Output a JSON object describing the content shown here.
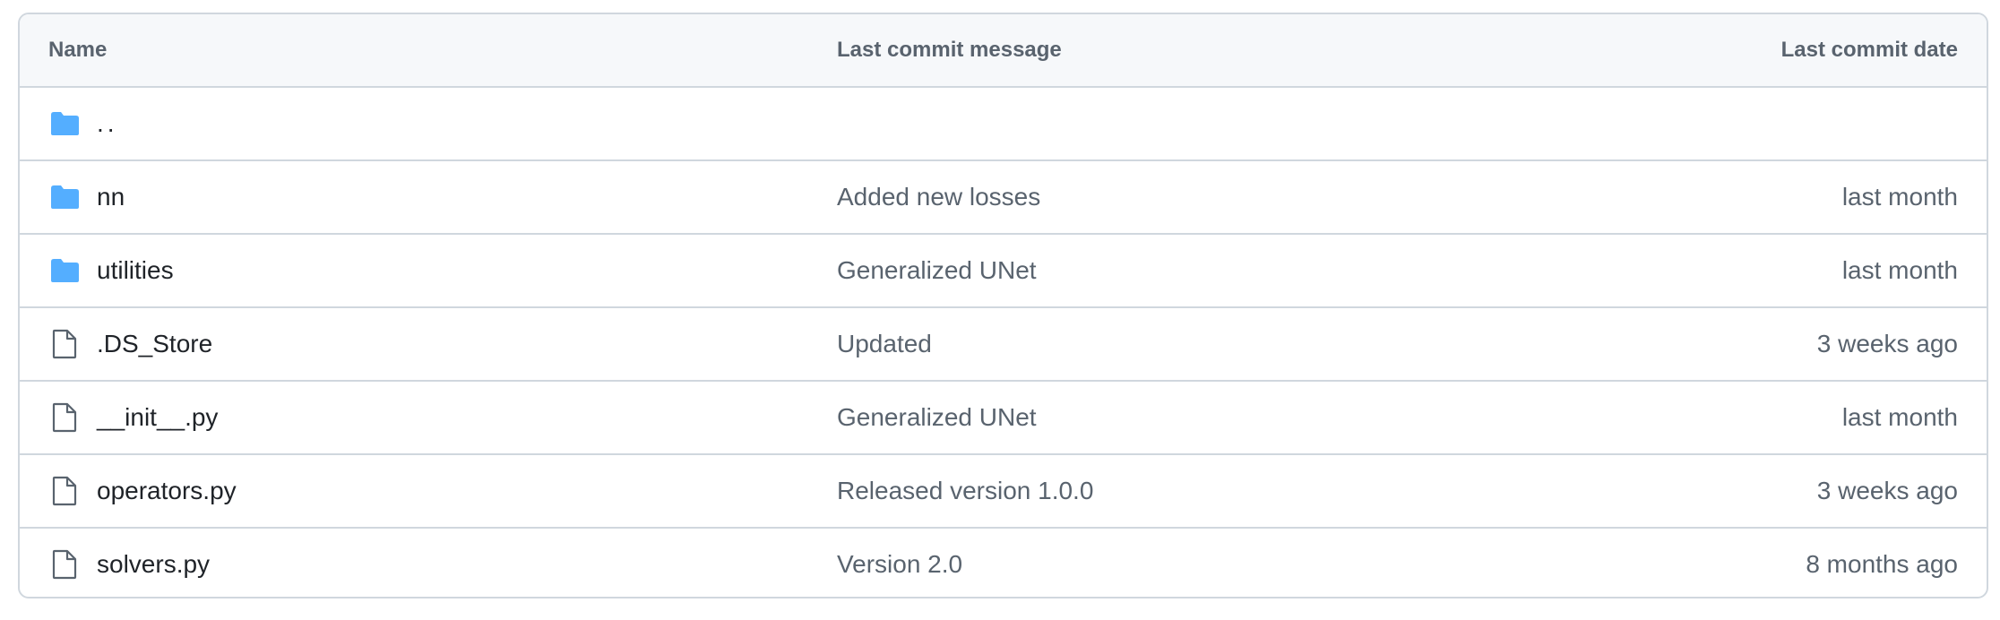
{
  "colors": {
    "folder_icon": "#54aeff",
    "file_icon": "#59636e",
    "border": "#d0d7de",
    "header_bg": "#f6f8fa",
    "text_primary": "#1f2328",
    "text_secondary": "#59636e"
  },
  "table": {
    "headers": {
      "name": "Name",
      "message": "Last commit message",
      "date": "Last commit date"
    },
    "parent": {
      "name": "..",
      "icon": "folder-icon"
    },
    "rows": [
      {
        "icon": "folder-icon",
        "name": "nn",
        "message": "Added new losses",
        "date": "last month"
      },
      {
        "icon": "folder-icon",
        "name": "utilities",
        "message": "Generalized UNet",
        "date": "last month"
      },
      {
        "icon": "file-icon",
        "name": ".DS_Store",
        "message": "Updated",
        "date": "3 weeks ago"
      },
      {
        "icon": "file-icon",
        "name": "__init__.py",
        "message": "Generalized UNet",
        "date": "last month"
      },
      {
        "icon": "file-icon",
        "name": "operators.py",
        "message": "Released version 1.0.0",
        "date": "3 weeks ago"
      },
      {
        "icon": "file-icon",
        "name": "solvers.py",
        "message": "Version 2.0",
        "date": "8 months ago"
      }
    ]
  }
}
